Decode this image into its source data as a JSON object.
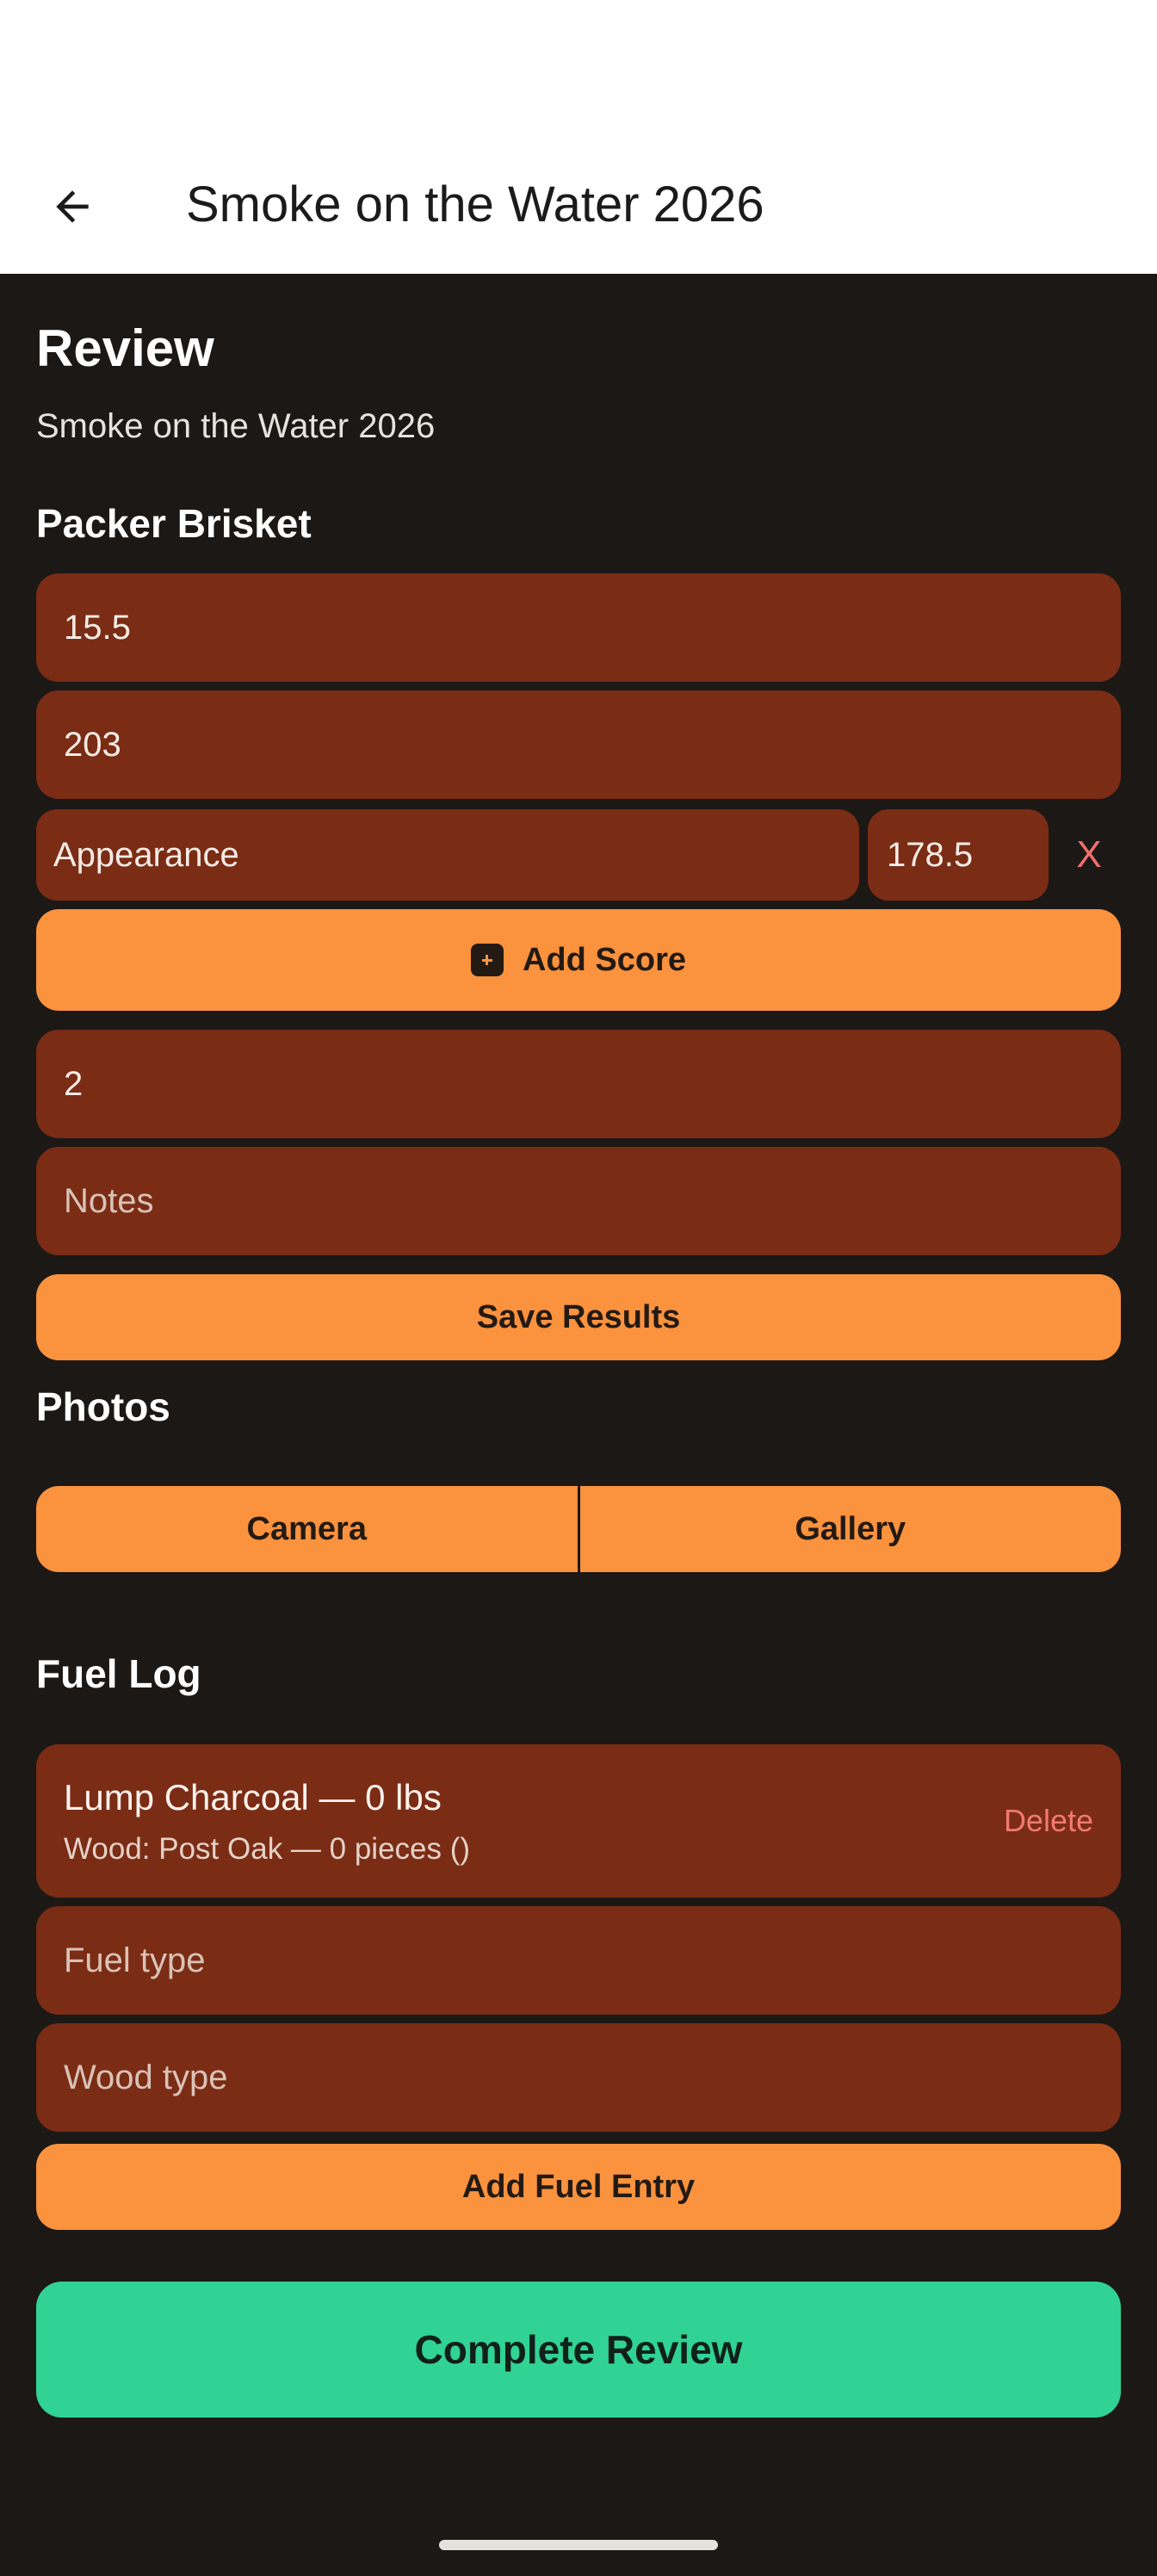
{
  "appbar": {
    "title": "Smoke on the Water 2026",
    "back_icon": "arrow-left-icon"
  },
  "review": {
    "heading": "Review",
    "subtitle": "Smoke on the Water 2026",
    "category": "Packer Brisket",
    "weight_value": "15.5",
    "temp_value": "203",
    "score": {
      "name": "Appearance",
      "value": "178.5",
      "remove_label": "X"
    },
    "add_score_label": "Add Score",
    "place_value": "2",
    "notes_placeholder": "Notes",
    "save_label": "Save Results"
  },
  "photos": {
    "heading": "Photos",
    "camera_label": "Camera",
    "gallery_label": "Gallery"
  },
  "fuel_log": {
    "heading": "Fuel Log",
    "entry": {
      "line1": "Lump Charcoal — 0 lbs",
      "line2": "Wood: Post Oak — 0 pieces ()",
      "delete_label": "Delete"
    },
    "fuel_type_placeholder": "Fuel type",
    "wood_type_placeholder": "Wood type",
    "add_label": "Add Fuel Entry"
  },
  "complete_label": "Complete Review",
  "colors": {
    "field": "#7b2c15",
    "accent": "#fa923e",
    "primary": "#30d394",
    "background": "#1c1816",
    "danger": "#f06e6e"
  }
}
